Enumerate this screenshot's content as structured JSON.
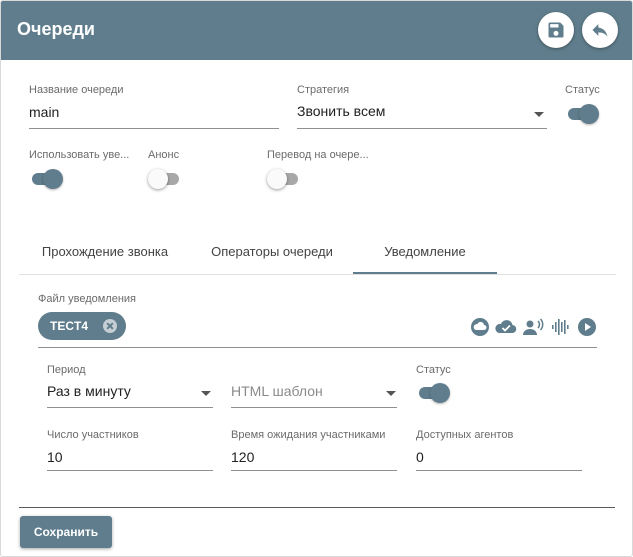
{
  "header": {
    "title": "Очереди",
    "save_icon": "floppy-disk-icon",
    "back_icon": "reply-arrow-icon"
  },
  "queue": {
    "name_label": "Название очереди",
    "name_value": "main",
    "strategy_label": "Стратегия",
    "strategy_value": "Звонить всем",
    "status_label": "Статус",
    "status_on": true
  },
  "toggles": {
    "use_notify_label": "Использовать уве...",
    "use_notify_on": true,
    "announce_label": "Анонс",
    "announce_on": false,
    "transfer_label": "Перевод на очере...",
    "transfer_on": false
  },
  "tabs": [
    {
      "label": "Прохождение звонка",
      "active": false
    },
    {
      "label": "Операторы очереди",
      "active": false
    },
    {
      "label": "Уведомление",
      "active": true
    }
  ],
  "notification": {
    "file_label": "Файл уведомления",
    "chip_label": "TECT4",
    "icons": [
      "cloud-icon",
      "cloud-check-icon",
      "voice-icon",
      "waveform-icon",
      "play-icon"
    ],
    "period_label": "Период",
    "period_value": "Раз в минуту",
    "html_placeholder": "HTML шаблон",
    "status_label": "Статус",
    "status_on": true,
    "participants_label": "Число участников",
    "participants_value": "10",
    "wait_label": "Время ожидания участниками",
    "wait_value": "120",
    "agents_label": "Доступных агентов",
    "agents_value": "0"
  },
  "footer": {
    "save_label": "Сохранить"
  },
  "colors": {
    "primary": "#5f7d8c",
    "header_text": "#ffffff",
    "label": "#6b6b6b"
  }
}
